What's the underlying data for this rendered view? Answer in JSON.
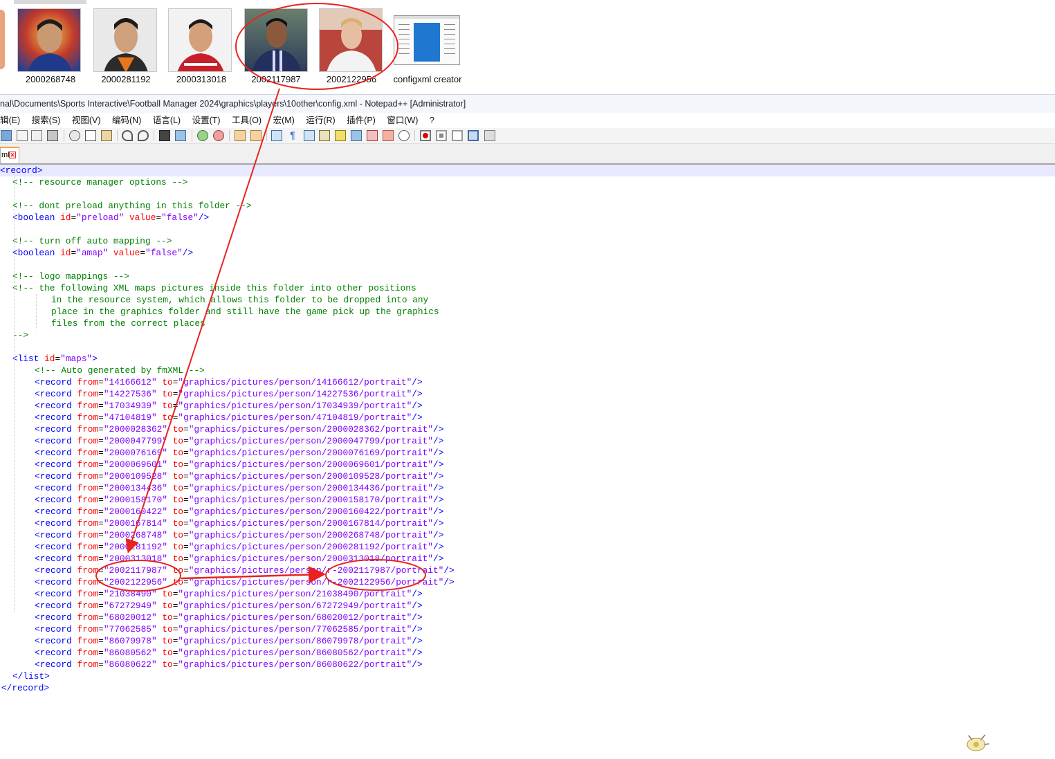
{
  "explorer": {
    "thumbnails": [
      {
        "label": "2000268748"
      },
      {
        "label": "2000281192"
      },
      {
        "label": "2000313018"
      },
      {
        "label": "2002117987"
      },
      {
        "label": "2002122956"
      }
    ],
    "file": {
      "name": "configxml creator",
      "icon": "document-file-icon"
    }
  },
  "window": {
    "title": "nal\\Documents\\Sports Interactive\\Football Manager 2024\\graphics\\players\\10other\\config.xml - Notepad++ [Administrator]"
  },
  "menu": [
    {
      "label": "辑(E)"
    },
    {
      "label": "搜索(S)"
    },
    {
      "label": "视图(V)"
    },
    {
      "label": "编码(N)"
    },
    {
      "label": "语言(L)"
    },
    {
      "label": "设置(T)"
    },
    {
      "label": "工具(O)"
    },
    {
      "label": "宏(M)"
    },
    {
      "label": "运行(R)"
    },
    {
      "label": "插件(P)"
    },
    {
      "label": "窗口(W)"
    },
    {
      "label": "?"
    }
  ],
  "tab": {
    "label": "ml",
    "close_icon": "close-icon"
  },
  "editor": {
    "lines": [
      "<record>",
      "<!-- resource manager options -->",
      "",
      "<!-- dont preload anything in this folder -->",
      "<boolean id=\"preload\" value=\"false\"/>",
      "",
      "<!-- turn off auto mapping -->",
      "<boolean id=\"amap\" value=\"false\"/>",
      "",
      "<!-- logo mappings -->",
      "<!-- the following XML maps pictures inside this folder into other positions",
      "in the resource system, which allows this folder to be dropped into any",
      "place in the graphics folder and still have the game pick up the graphics",
      "files from the correct places",
      "-->",
      "",
      "<list id=\"maps\">",
      "<!-- Auto generated by fmXML -->",
      "<record from=\"14166612\" to=\"graphics/pictures/person/14166612/portrait\"/>",
      "<record from=\"14227536\" to=\"graphics/pictures/person/14227536/portrait\"/>",
      "<record from=\"17034939\" to=\"graphics/pictures/person/17034939/portrait\"/>",
      "<record from=\"47104819\" to=\"graphics/pictures/person/47104819/portrait\"/>",
      "<record from=\"2000028362\" to=\"graphics/pictures/person/2000028362/portrait\"/>",
      "<record from=\"2000047799\" to=\"graphics/pictures/person/2000047799/portrait\"/>",
      "<record from=\"2000076169\" to=\"graphics/pictures/person/2000076169/portrait\"/>",
      "<record from=\"2000069601\" to=\"graphics/pictures/person/2000069601/portrait\"/>",
      "<record from=\"2000109528\" to=\"graphics/pictures/person/2000109528/portrait\"/>",
      "<record from=\"2000134436\" to=\"graphics/pictures/person/2000134436/portrait\"/>",
      "<record from=\"2000158170\" to=\"graphics/pictures/person/2000158170/portrait\"/>",
      "<record from=\"2000160422\" to=\"graphics/pictures/person/2000160422/portrait\"/>",
      "<record from=\"2000167814\" to=\"graphics/pictures/person/2000167814/portrait\"/>",
      "<record from=\"2000268748\" to=\"graphics/pictures/person/2000268748/portrait\"/>",
      "<record from=\"2000281192\" to=\"graphics/pictures/person/2000281192/portrait\"/>",
      "<record from=\"2000313018\" to=\"graphics/pictures/person/2000313018/portrait\"/>",
      "<record from=\"2002117987\" to=\"graphics/pictures/person/r-2002117987/portrait\"/>",
      "<record from=\"2002122956\" to=\"graphics/pictures/person/r-2002122956/portrait\"/>",
      "<record from=\"21038490\" to=\"graphics/pictures/person/21038490/portrait\"/>",
      "<record from=\"67272949\" to=\"graphics/pictures/person/67272949/portrait\"/>",
      "<record from=\"68020012\" to=\"graphics/pictures/person/68020012/portrait\"/>",
      "<record from=\"77062585\" to=\"graphics/pictures/person/77062585/portrait\"/>",
      "<record from=\"86079978\" to=\"graphics/pictures/person/86079978/portrait\"/>",
      "<record from=\"86080562\" to=\"graphics/pictures/person/86080562/portrait\"/>",
      "<record from=\"86080622\" to=\"graphics/pictures/person/86080622/portrait\"/>",
      "</list>",
      "</record>"
    ]
  },
  "colors": {
    "tag": "#0000ff",
    "attribute": "#ff0000",
    "value": "#8000ff",
    "comment": "#008000",
    "annotation": "#e8231f"
  }
}
